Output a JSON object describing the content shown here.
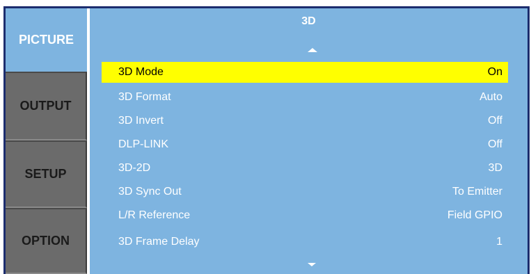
{
  "sidebar": {
    "tabs": [
      {
        "label": "PICTURE",
        "active": true
      },
      {
        "label": "OUTPUT",
        "active": false
      },
      {
        "label": "SETUP",
        "active": false
      },
      {
        "label": "OPTION",
        "active": false
      }
    ]
  },
  "main": {
    "title": "3D",
    "scroll_up_icon": "triangle-up",
    "scroll_down_icon": "triangle-down",
    "rows": [
      {
        "label": "3D Mode",
        "value": "On",
        "selected": true
      },
      {
        "label": "3D Format",
        "value": "Auto"
      },
      {
        "label": "3D Invert",
        "value": "Off"
      },
      {
        "label": "DLP-LINK",
        "value": "Off"
      },
      {
        "label": "3D-2D",
        "value": "3D"
      },
      {
        "label": "3D Sync Out",
        "value": "To Emitter"
      },
      {
        "label": "L/R Reference",
        "value": "Field GPIO"
      },
      {
        "label": "3D Frame Delay",
        "value": "1"
      }
    ]
  },
  "colors": {
    "panel_blue": "#7eb4e0",
    "highlight": "#ffff00",
    "inactive_tab": "#6b6b6b",
    "frame_border": "#1c2d6e"
  }
}
